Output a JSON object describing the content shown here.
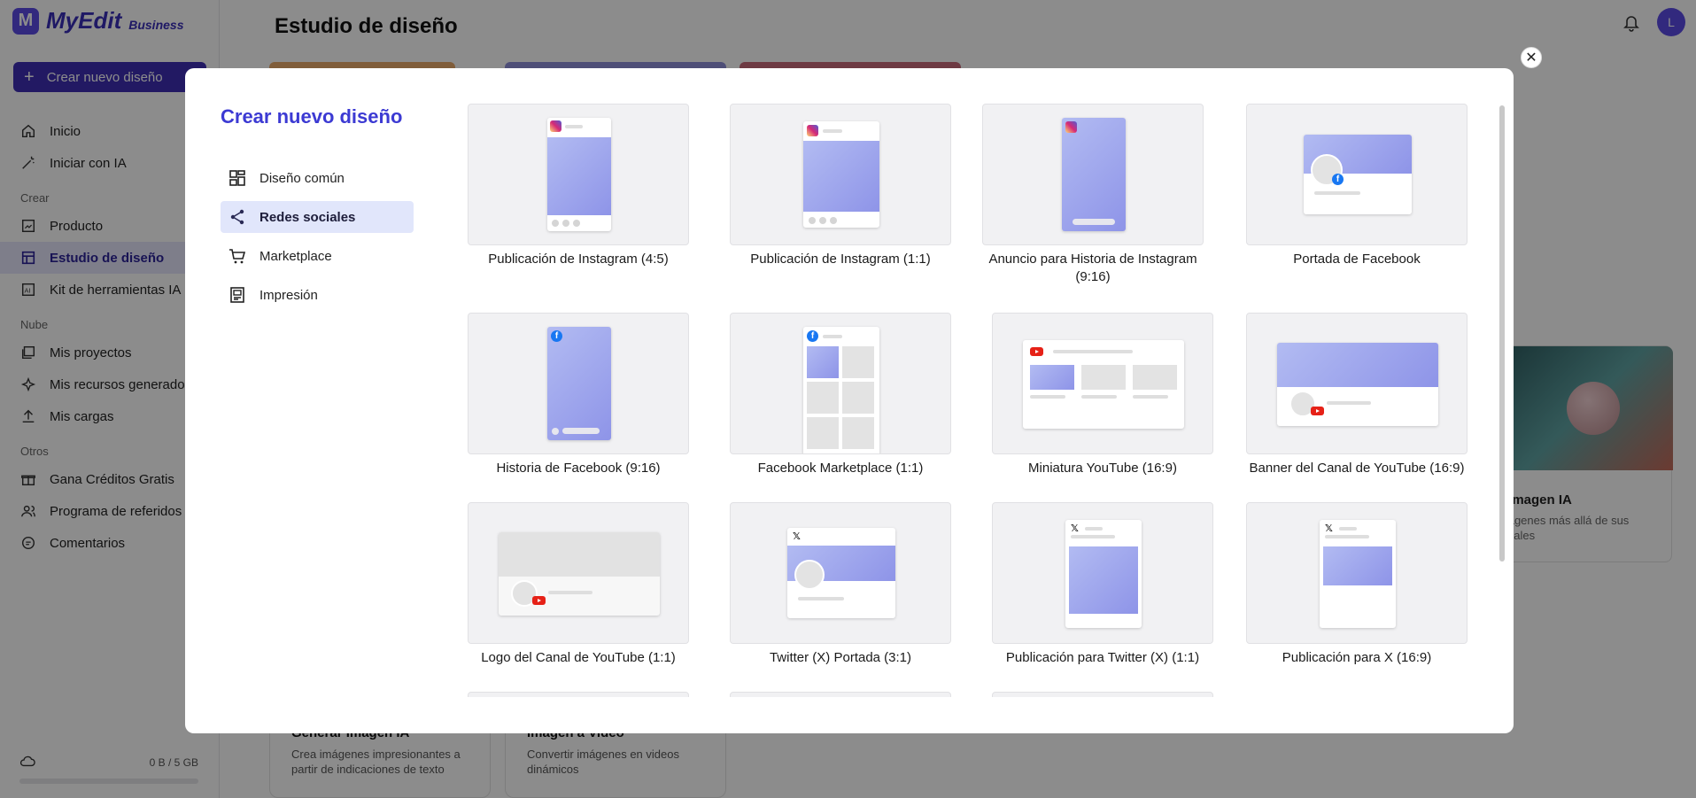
{
  "app": {
    "brand": "MyEdit",
    "brand_sub": "Business",
    "logo_letter": "M",
    "accent": "#3f2fb5",
    "create_button": "Crear nuevo diseño"
  },
  "sidebar": {
    "items_top": [
      {
        "label": "Inicio",
        "icon": "home-icon"
      },
      {
        "label": "Iniciar con IA",
        "icon": "magic-wand-icon"
      }
    ],
    "section_crear": "Crear",
    "items_crear": [
      {
        "label": "Producto",
        "icon": "product-icon"
      },
      {
        "label": "Estudio de diseño",
        "icon": "design-studio-icon"
      },
      {
        "label": "Kit de herramientas IA",
        "icon": "ai-toolkit-icon"
      }
    ],
    "section_nube": "Nube",
    "items_nube": [
      {
        "label": "Mis proyectos",
        "icon": "projects-icon"
      },
      {
        "label": "Mis recursos generados",
        "icon": "sparkles-icon"
      },
      {
        "label": "Mis cargas",
        "icon": "upload-icon"
      }
    ],
    "section_otros": "Otros",
    "items_otros": [
      {
        "label": "Gana Créditos Gratis",
        "icon": "gift-icon"
      },
      {
        "label": "Programa de referidos",
        "icon": "users-icon"
      },
      {
        "label": "Comentarios",
        "icon": "comment-icon"
      }
    ],
    "storage": "0 B / 5 GB"
  },
  "main": {
    "title": "Estudio de diseño",
    "avatar_letter": "L",
    "cards": [
      {
        "title": "Generar Imagen IA",
        "desc": "Crea imágenes impresionantes a partir de indicaciones de texto"
      },
      {
        "title": "Imagen a Video",
        "desc": "Convertir imágenes en videos dinámicos"
      }
    ],
    "right_card": {
      "title": "ir Imagen IA",
      "desc": "imágenes más allá de sus iginales"
    }
  },
  "modal": {
    "title": "Crear nuevo diseño",
    "categories": [
      {
        "label": "Diseño común",
        "icon": "grid-layout-icon"
      },
      {
        "label": "Redes sociales",
        "icon": "share-icon"
      },
      {
        "label": "Marketplace",
        "icon": "cart-icon"
      },
      {
        "label": "Impresión",
        "icon": "print-icon"
      }
    ],
    "active_category": "Redes sociales",
    "templates": [
      "Publicación de Instagram (4:5)",
      "Publicación de Instagram (1:1)",
      "Anuncio para Historia de Instagram (9:16)",
      "Portada de Facebook",
      "Historia de Facebook (9:16)",
      "Facebook Marketplace (1:1)",
      "Miniatura YouTube (16:9)",
      "Banner del Canal de YouTube (16:9)",
      "Logo del Canal de YouTube (1:1)",
      "Twitter (X) Portada (3:1)",
      "Publicación para Twitter (X) (1:1)",
      "Publicación para X (16:9)"
    ]
  }
}
